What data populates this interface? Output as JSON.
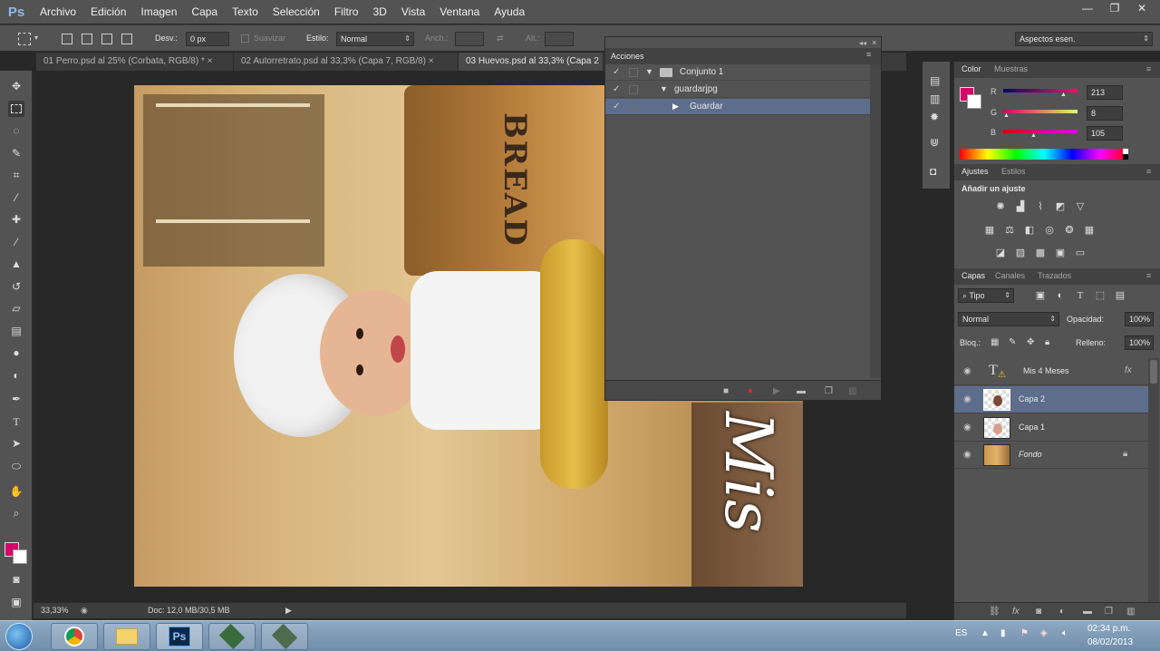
{
  "app": {
    "logo": "Ps"
  },
  "menu": [
    "Archivo",
    "Edición",
    "Imagen",
    "Capa",
    "Texto",
    "Selección",
    "Filtro",
    "3D",
    "Vista",
    "Ventana",
    "Ayuda"
  ],
  "window_controls": {
    "minimize": "—",
    "restore": "❐",
    "close": "✕"
  },
  "options": {
    "feather_label": "Desv.:",
    "feather_value": "0 px",
    "smooth_label": "Suavizar",
    "style_label": "Estilo:",
    "style_value": "Normal",
    "width_label": "Anch.:",
    "height_label": "Alt.:",
    "workspace_value": "Aspectos esen."
  },
  "tabs": [
    "01 Perro.psd al 25% (Corbata, RGB/8) * ×",
    "02 Autorretrato.psd al 33,3% (Capa 7, RGB/8) ×",
    "03 Huevos.psd al 33,3% (Capa 2"
  ],
  "canvas_text": {
    "bread": "BREAD",
    "script": "Mis"
  },
  "status": {
    "zoom": "33,33%",
    "doc": "Doc: 12,0 MB/30,5 MB"
  },
  "actions_panel": {
    "title": "Acciones",
    "rows": [
      {
        "label": "Conjunto 1",
        "selected": false
      },
      {
        "label": "guardarjpg",
        "selected": false
      },
      {
        "label": "Guardar",
        "selected": true
      }
    ]
  },
  "color_panel": {
    "tabs": [
      "Color",
      "Muestras"
    ],
    "channels": [
      {
        "name": "R",
        "value": "213"
      },
      {
        "name": "G",
        "value": "8"
      },
      {
        "name": "B",
        "value": "105"
      }
    ],
    "foreground": "#d50869"
  },
  "adjust_panel": {
    "tabs": [
      "Ajustes",
      "Estilos"
    ],
    "heading": "Añadir un ajuste"
  },
  "layers_panel": {
    "tabs": [
      "Capas",
      "Canales",
      "Trazados"
    ],
    "filter_value": "Tipo",
    "blend_mode": "Normal",
    "opacity_label": "Opacidad:",
    "opacity_value": "100%",
    "lock_label": "Bloq.:",
    "fill_label": "Relleno:",
    "fill_value": "100%",
    "layers": [
      {
        "name": "Mis 4 Meses",
        "selected": false
      },
      {
        "name": "Capa 2",
        "selected": true
      },
      {
        "name": "Capa 1",
        "selected": false
      },
      {
        "name": "Fondo",
        "selected": false
      }
    ]
  },
  "taskbar": {
    "ps_label": "Ps",
    "lang": "ES",
    "time": "02:34 p.m.",
    "date": "08/02/2013"
  }
}
